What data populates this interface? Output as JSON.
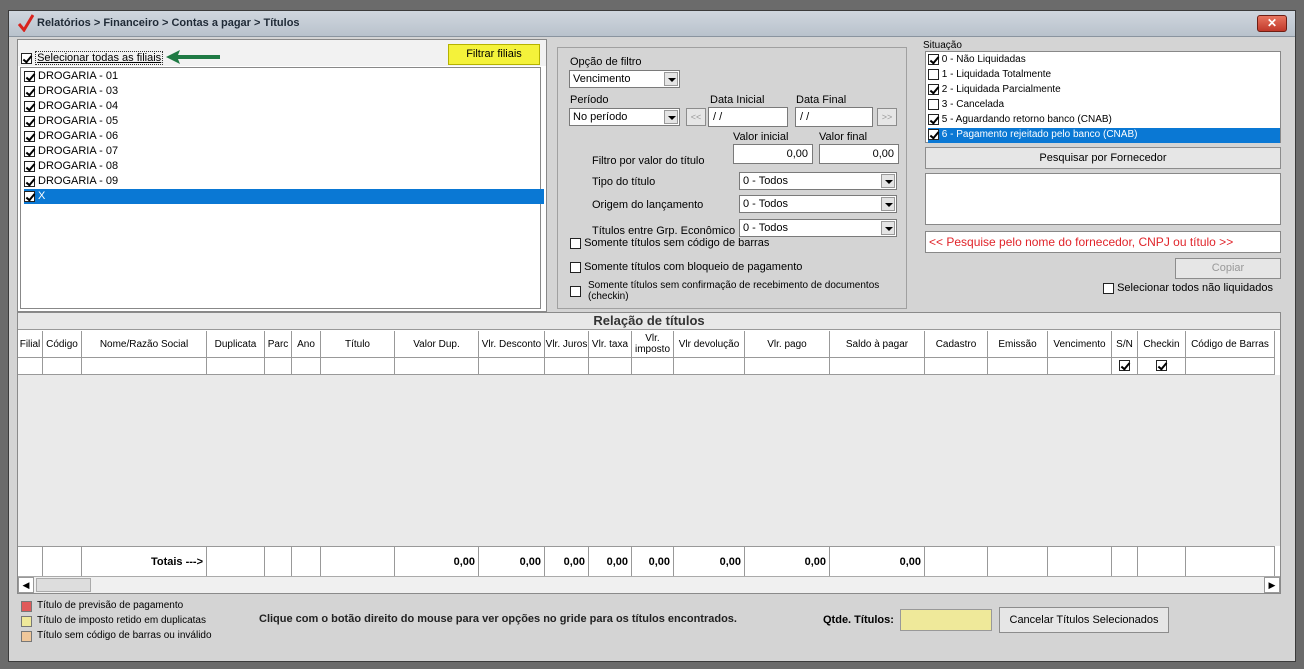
{
  "window": {
    "title": "Relatórios > Financeiro > Contas a pagar > Títulos",
    "close": "✕"
  },
  "filiais": {
    "select_all_label": "Selecionar todas as filiais",
    "filter_button": "Filtrar filiais",
    "items": [
      {
        "label": "DROGARIA - 01",
        "checked": true
      },
      {
        "label": "DROGARIA - 03",
        "checked": true
      },
      {
        "label": "DROGARIA - 04",
        "checked": true
      },
      {
        "label": "DROGARIA - 05",
        "checked": true
      },
      {
        "label": "DROGARIA - 06",
        "checked": true
      },
      {
        "label": "DROGARIA - 07",
        "checked": true
      },
      {
        "label": "DROGARIA - 08",
        "checked": true
      },
      {
        "label": "DROGARIA - 09",
        "checked": true
      },
      {
        "label": "X",
        "checked": true
      }
    ]
  },
  "filtro": {
    "opcao_label": "Opção de filtro",
    "opcao_value": "Vencimento",
    "periodo_label": "Período",
    "periodo_value": "No período",
    "data_inicial_label": "Data Inicial",
    "data_final_label": "Data Final",
    "data_inicial_value": " / /",
    "data_final_value": " / /",
    "prev_btn": "<<",
    "next_btn": ">>",
    "valor_inicial_label": "Valor inicial",
    "valor_final_label": "Valor final",
    "valor_inicial_value": "0,00",
    "valor_final_value": "0,00",
    "filtro_valor_label": "Filtro por valor do título",
    "tipo_label": "Tipo do título",
    "tipo_value": "0 - Todos",
    "origem_label": "Origem do lançamento",
    "origem_value": "0 - Todos",
    "grupo_label": "Títulos entre Grp. Econômico",
    "grupo_value": "0 - Todos",
    "sem_codigo_label": "Somente títulos sem código de barras",
    "bloqueio_label": "Somente títulos com bloqueio de pagamento",
    "checkin_label": "Somente títulos sem confirmação de recebimento de documentos (checkin)"
  },
  "situacao": {
    "label": "Situação",
    "items": [
      {
        "label": "0 - Não Liquidadas",
        "checked": true
      },
      {
        "label": "1 - Liquidada Totalmente",
        "checked": false
      },
      {
        "label": "2 - Liquidada Parcialmente",
        "checked": true
      },
      {
        "label": "3 - Cancelada",
        "checked": false
      },
      {
        "label": "5 - Aguardando retorno banco (CNAB)",
        "checked": true
      },
      {
        "label": "6 - Pagamento rejeitado pelo banco (CNAB)",
        "checked": true
      }
    ],
    "pesquisar_button": "Pesquisar por Fornecedor",
    "hint": "<< Pesquise pelo nome do fornecedor, CNPJ ou título >>",
    "copiar_button": "Copiar",
    "selecionar_nao_liquidados": "Selecionar todos não liquidados"
  },
  "grid": {
    "title": "Relação de títulos",
    "columns": [
      "Filial",
      "Código",
      "Nome/Razão Social",
      "Duplicata",
      "Parc",
      "Ano",
      "Título",
      "Valor Dup.",
      "Vlr. Desconto",
      "Vlr. Juros",
      "Vlr. taxa",
      "Vlr. imposto",
      "Vlr devolução",
      "Vlr. pago",
      "Saldo à pagar",
      "Cadastro",
      "Emissão",
      "Vencimento",
      "S/N",
      "Checkin",
      "Código de Barras"
    ],
    "totais_label": "Totais --->",
    "totals": {
      "valor_dup": "0,00",
      "desconto": "0,00",
      "juros": "0,00",
      "taxa": "0,00",
      "imposto": "0,00",
      "devolucao": "0,00",
      "pago": "0,00",
      "saldo": "0,00"
    }
  },
  "footer": {
    "legend": [
      {
        "label": "Título de previsão de pagamento",
        "color": "#e05a5a"
      },
      {
        "label": "Título de imposto retido em duplicatas",
        "color": "#efe99a"
      },
      {
        "label": "Título sem código de barras ou inválido",
        "color": "#f0c79a"
      }
    ],
    "hint": "Clique com o botão direito do mouse para ver opções no gride para os títulos encontrados.",
    "qtde_label": "Qtde. Títulos:",
    "cancelar_button": "Cancelar Títulos Selecionados"
  }
}
